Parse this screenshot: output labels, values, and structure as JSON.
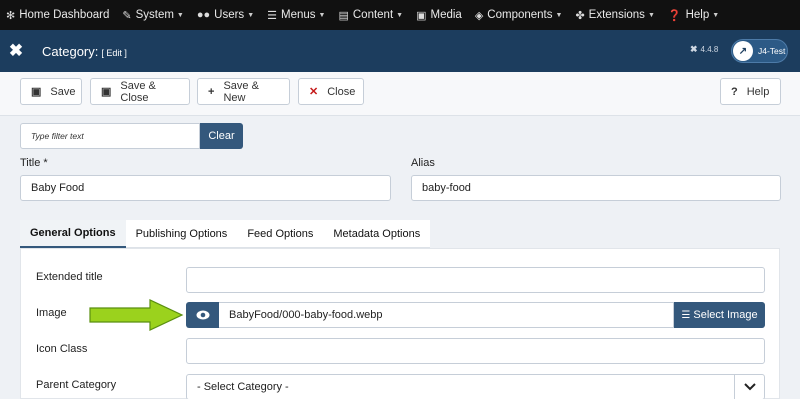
{
  "topmenu": [
    {
      "icon": "joomla-icon",
      "glyph": "✻",
      "label": "Home Dashboard",
      "caret": false
    },
    {
      "icon": "wrench-icon",
      "glyph": "🔧",
      "label": "System",
      "caret": true
    },
    {
      "icon": "users-icon",
      "glyph": "👥",
      "label": "Users",
      "caret": true
    },
    {
      "icon": "menus-icon",
      "glyph": "☰",
      "label": "Menus",
      "caret": true
    },
    {
      "icon": "file-icon",
      "glyph": "▤",
      "label": "Content",
      "caret": true
    },
    {
      "icon": "image-icon",
      "glyph": "▣",
      "label": "Media",
      "caret": false
    },
    {
      "icon": "cube-icon",
      "glyph": "◈",
      "label": "Components",
      "caret": true
    },
    {
      "icon": "puzzle-icon",
      "glyph": "✤",
      "label": "Extensions",
      "caret": true
    },
    {
      "icon": "help-icon",
      "glyph": "?",
      "label": "Help",
      "caret": true
    }
  ],
  "header": {
    "title": "Category:",
    "edit": "[ Edit ]",
    "version": "4.4.8",
    "site": "J4-Test"
  },
  "toolbar": {
    "save": "Save",
    "save_close": "Save & Close",
    "save_new": "Save & New",
    "close": "Close",
    "help": "Help"
  },
  "filter": {
    "placeholder": "Type filter text",
    "clear": "Clear"
  },
  "fields": {
    "title_label": "Title *",
    "title_value": "Baby Food",
    "alias_label": "Alias",
    "alias_value": "baby-food"
  },
  "tabs": [
    "General Options",
    "Publishing Options",
    "Feed Options",
    "Metadata Options"
  ],
  "general": {
    "extended_title_label": "Extended title",
    "extended_title_value": "",
    "image_label": "Image",
    "image_value": "BabyFood/000-baby-food.webp",
    "select_image": "Select Image",
    "icon_class_label": "Icon Class",
    "icon_class_value": "",
    "parent_label": "Parent Category",
    "parent_value": "- Select Category -"
  },
  "colors": {
    "header_bg": "#1c3d5e",
    "accent": "#34587c",
    "arrow": "#9bd21d"
  }
}
